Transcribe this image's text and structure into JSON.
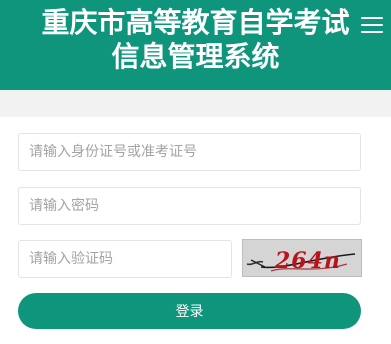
{
  "header": {
    "title_line1": "重庆市高等教育自学考试",
    "title_line2": "信息管理系统",
    "menu_icon": "hamburger-menu-icon"
  },
  "form": {
    "id_placeholder": "请输入身份证号或准考证号",
    "id_value": "",
    "password_placeholder": "请输入密码",
    "password_value": "",
    "captcha_placeholder": "请输入验证码",
    "captcha_value": "",
    "captcha_text": "264n",
    "login_label": "登录"
  },
  "colors": {
    "brand": "#0e957c",
    "page_background": "#f2f2f2",
    "captcha_text": "#b8141a"
  }
}
